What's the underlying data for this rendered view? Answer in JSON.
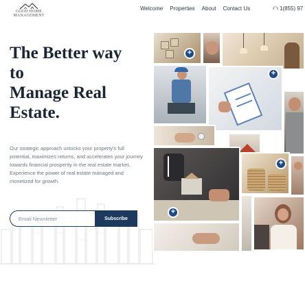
{
  "logo": {
    "line1": "GOOD HOME",
    "line2": "MANAGEMENT",
    "icon": "house-roof-logo"
  },
  "nav": {
    "items": [
      {
        "label": "Welcome"
      },
      {
        "label": "Properties"
      },
      {
        "label": "About"
      },
      {
        "label": "Contact Us"
      }
    ],
    "phone": "1(855) 97",
    "phone_icon": "phone-icon"
  },
  "hero": {
    "title_lines": [
      "The Better way",
      "to",
      "Manage Real",
      "Estate."
    ],
    "description": "Our strategic approach unlocks your property's full potential, maximizes returns, and accelerates your journey towards financial prosperity in the real estate market. Experience the power of real estate managed and monetized for growth."
  },
  "newsletter": {
    "placeholder": "Email Newsletter",
    "button_label": "Subscribe"
  },
  "collage": {
    "tiles": [
      {
        "name": "coin-blocks",
        "color": "#b9a27f"
      },
      {
        "name": "woman-portrait",
        "color": "#8a6e5a"
      },
      {
        "name": "lamp-interior",
        "color": "#d9c7a8"
      },
      {
        "name": "worker-kneeling",
        "color": "#5b7fa6"
      },
      {
        "name": "clipboard-checklist",
        "color": "#c9d3df"
      },
      {
        "name": "man-right",
        "color": "#7a6a5c"
      },
      {
        "name": "handshake-keys",
        "color": "#d7cbbd"
      },
      {
        "name": "house-model",
        "color": "#b8402f"
      },
      {
        "name": "business-desk",
        "color": "#3d3b3e"
      },
      {
        "name": "coins-stack",
        "color": "#c4a57a"
      },
      {
        "name": "family",
        "color": "#a88f7d"
      },
      {
        "name": "documents",
        "color": "#e2ddd6"
      },
      {
        "name": "woman-smiling",
        "color": "#b47a5f"
      }
    ],
    "accent": "#1f4a86"
  },
  "colors": {
    "navy": "#1d3a5e",
    "title": "#1a2636",
    "text": "#6b7682"
  }
}
